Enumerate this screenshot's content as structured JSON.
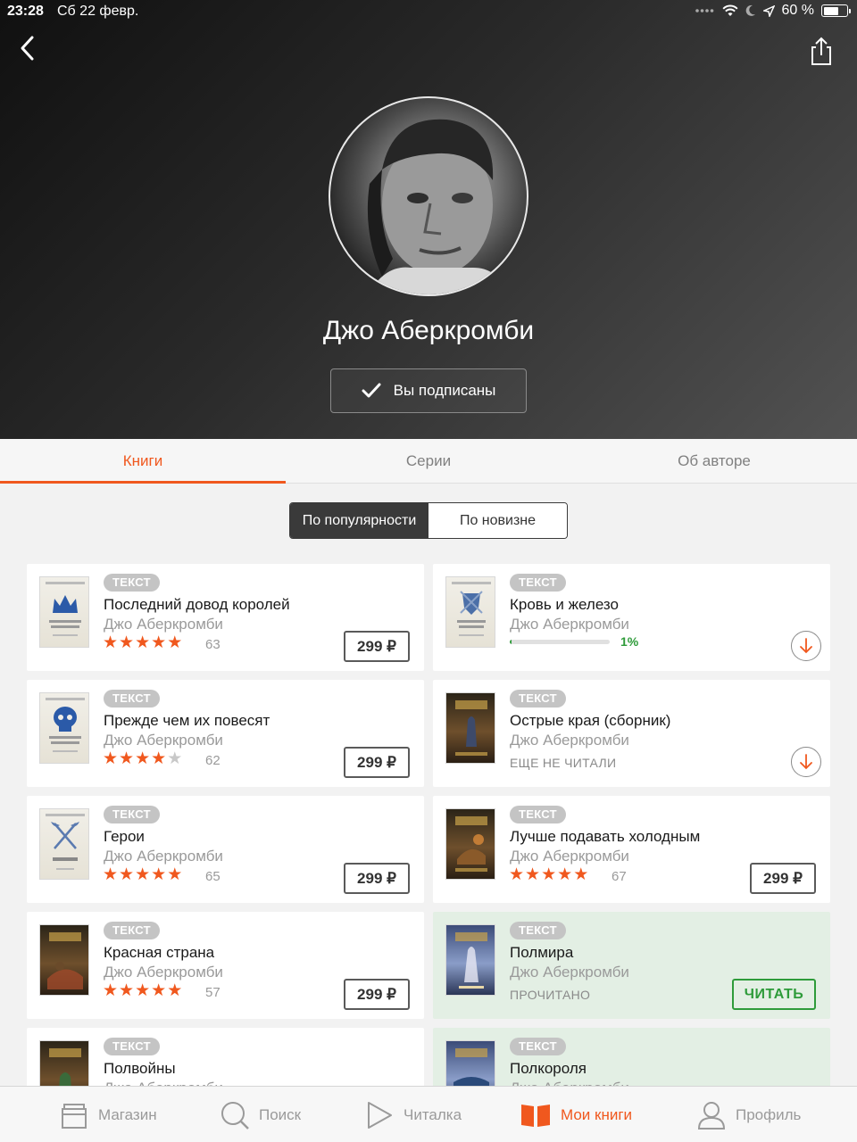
{
  "status_bar": {
    "time": "23:28",
    "date": "Сб 22 февр.",
    "battery": "60 %"
  },
  "author": {
    "name": "Джо Аберкромби",
    "subscribe_label": "Вы подписаны"
  },
  "tabs": [
    {
      "label": "Книги",
      "active": true
    },
    {
      "label": "Серии",
      "active": false
    },
    {
      "label": "Об авторе",
      "active": false
    }
  ],
  "sort": [
    {
      "label": "По популярности",
      "active": true
    },
    {
      "label": "По новизне",
      "active": false
    }
  ],
  "books": [
    {
      "badge": "ТЕКСТ",
      "title": "Последний довод королей",
      "author": "Джо Аберкромби",
      "rating": 5,
      "reviews": "63",
      "price": "299 ₽",
      "cover": "light-crown"
    },
    {
      "badge": "ТЕКСТ",
      "title": "Кровь и железо",
      "author": "Джо Аберкромби",
      "progress": 0.01,
      "progress_label": "1%",
      "cover": "light-shield"
    },
    {
      "badge": "ТЕКСТ",
      "title": "Прежде чем их повесят",
      "author": "Джо Аберкромби",
      "rating": 4,
      "reviews": "62",
      "price": "299 ₽",
      "cover": "light-skull"
    },
    {
      "badge": "ТЕКСТ",
      "title": "Острые края (сборник)",
      "author": "Джо Аберкромби",
      "status": "ЕЩЕ НЕ ЧИТАЛИ",
      "cover": "dark"
    },
    {
      "badge": "ТЕКСТ",
      "title": "Герои",
      "author": "Джо Аберкромби",
      "rating": 5,
      "reviews": "65",
      "price": "299 ₽",
      "cover": "light-axes"
    },
    {
      "badge": "ТЕКСТ",
      "title": "Лучше подавать холодным",
      "author": "Джо Аберкромби",
      "rating": 5,
      "reviews": "67",
      "price": "299 ₽",
      "cover": "dark"
    },
    {
      "badge": "ТЕКСТ",
      "title": "Красная страна",
      "author": "Джо Аберкромби",
      "rating": 5,
      "reviews": "57",
      "price": "299 ₽",
      "cover": "dark"
    },
    {
      "badge": "ТЕКСТ",
      "title": "Полмира",
      "author": "Джо Аберкромби",
      "status": "ПРОЧИТАНО",
      "action": "ЧИТАТЬ",
      "cover": "blue"
    },
    {
      "badge": "ТЕКСТ",
      "title": "Полвойны",
      "author": "Джо Аберкромби",
      "cover": "dark"
    },
    {
      "badge": "ТЕКСТ",
      "title": "Полкороля",
      "author": "Джо Аберкромби",
      "cover": "blue"
    }
  ],
  "bottom_nav": [
    {
      "label": "Магазин",
      "icon": "store-icon",
      "active": false
    },
    {
      "label": "Поиск",
      "icon": "search-icon",
      "active": false
    },
    {
      "label": "Читалка",
      "icon": "play-icon",
      "active": false
    },
    {
      "label": "Мои книги",
      "icon": "book-icon",
      "active": true
    },
    {
      "label": "Профиль",
      "icon": "profile-icon",
      "active": false
    }
  ],
  "colors": {
    "accent": "#f0581e",
    "read_green": "#2e9b3a",
    "read_card_bg": "#e3efe4"
  }
}
